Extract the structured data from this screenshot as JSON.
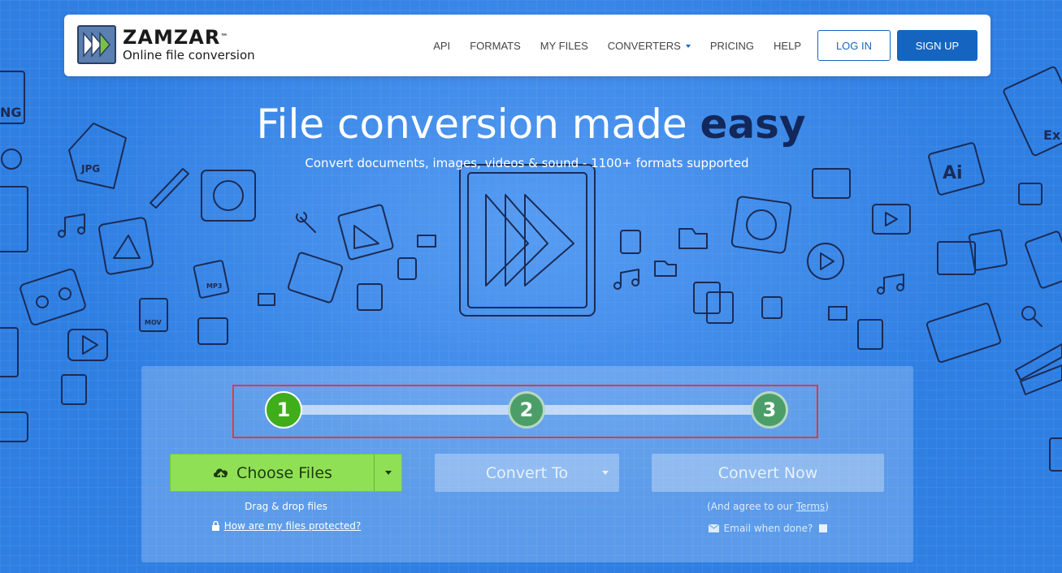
{
  "brand": {
    "name": "ZAMZAR",
    "tm": "™",
    "tagline": "Online file conversion"
  },
  "nav": {
    "items": [
      {
        "label": "API"
      },
      {
        "label": "FORMATS"
      },
      {
        "label": "MY FILES"
      },
      {
        "label": "CONVERTERS"
      },
      {
        "label": "PRICING"
      },
      {
        "label": "HELP"
      }
    ],
    "login": "LOG IN",
    "signup": "SIGN UP"
  },
  "hero": {
    "title_main": "File conversion made ",
    "title_emphasis": "easy",
    "subtitle": "Convert documents, images, videos & sound - 1100+ formats supported"
  },
  "steps": [
    "1",
    "2",
    "3"
  ],
  "converter": {
    "choose_files": "Choose Files",
    "drag_drop": "Drag & drop files",
    "protected_link": "How are my files protected?",
    "convert_to": "Convert To",
    "convert_now": "Convert Now",
    "agree_prefix": "(And agree to our ",
    "terms": "Terms",
    "agree_suffix": ")",
    "email_when_done": "Email when done?"
  },
  "doodle_labels": {
    "jpg": "JPG",
    "mp3": "MP3",
    "mov": "MOV",
    "ai": "Ai",
    "png": "NG",
    "ex": "Ex"
  },
  "colors": {
    "background": "#2f7fe3",
    "primary": "#1565c0",
    "choose_green": "#8fe055",
    "step_active": "#3fae1a",
    "step_inactive": "#4c9e68",
    "highlight_red": "#e53935"
  },
  "icons": [
    "logo-arrows-icon",
    "cloud-upload-icon",
    "lock-icon",
    "envelope-icon",
    "dropdown-caret-icon",
    "play-forward-icon"
  ]
}
